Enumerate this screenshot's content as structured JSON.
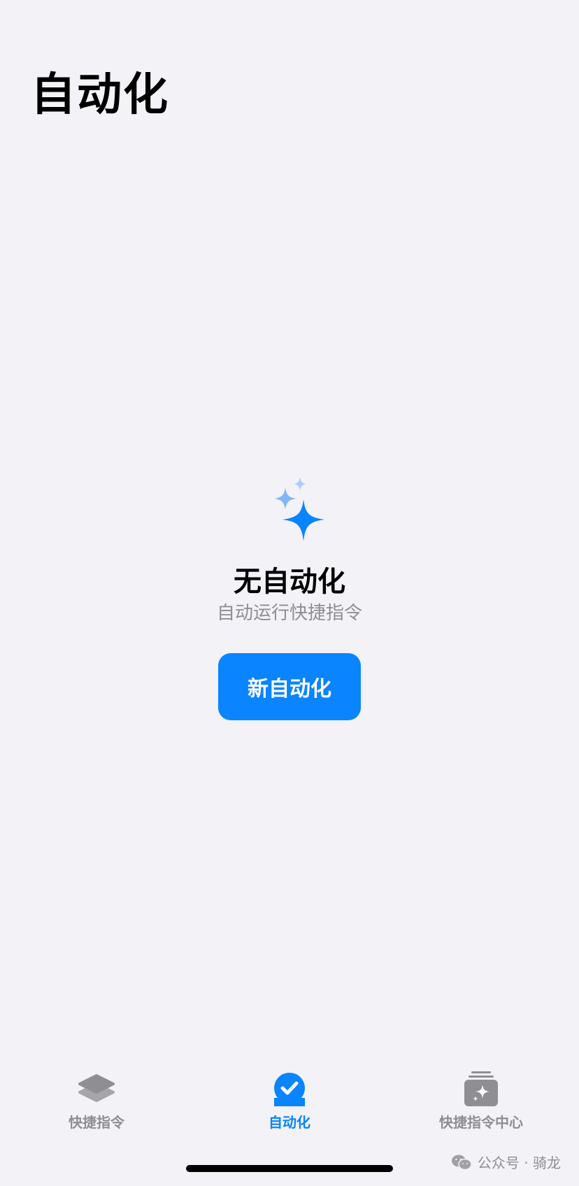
{
  "header": {
    "title": "自动化"
  },
  "empty_state": {
    "icon": "sparkles-icon",
    "title": "无自动化",
    "subtitle": "自动运行快捷指令",
    "button_label": "新自动化"
  },
  "tab_bar": {
    "active": "自动化",
    "tabs": [
      {
        "label": "快捷指令",
        "icon": "layers-icon"
      },
      {
        "label": "自动化",
        "icon": "checkmark-circle-icon"
      },
      {
        "label": "快捷指令中心",
        "icon": "gallery-sparkle-icon"
      }
    ]
  },
  "watermark": {
    "text": "公众号 · 骑龙"
  },
  "colors": {
    "accent": "#0a84ff",
    "background": "#f2f2f7",
    "secondary_text": "#8e8e93",
    "inactive_icon": "#8e8e93"
  }
}
